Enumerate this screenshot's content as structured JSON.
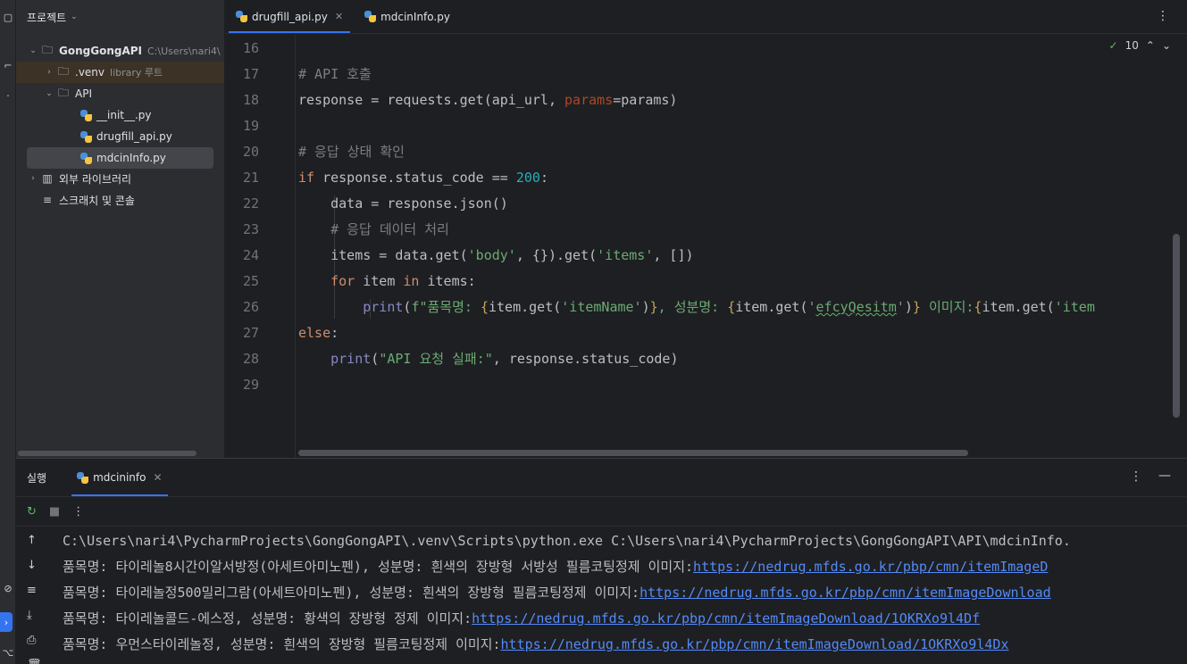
{
  "project": {
    "title": "프로젝트",
    "items": [
      {
        "label": "GongGongAPI",
        "extra": "C:\\Users\\nari4\\"
      },
      {
        "label": ".venv",
        "extra": "library 루트"
      },
      {
        "label": "API"
      },
      {
        "label": "__init__.py"
      },
      {
        "label": "drugfill_api.py"
      },
      {
        "label": "mdcinInfo.py"
      },
      {
        "label": "외부 라이브러리"
      },
      {
        "label": "스크래치 및 콘솔"
      }
    ]
  },
  "editor": {
    "tabs": [
      {
        "label": "drugfill_api.py"
      },
      {
        "label": "mdcinInfo.py"
      }
    ],
    "inspection_count": "10",
    "line_numbers": [
      "16",
      "17",
      "18",
      "19",
      "20",
      "21",
      "22",
      "23",
      "24",
      "25",
      "26",
      "27",
      "28",
      "29"
    ],
    "code": {
      "l17": "# API 호출",
      "l18_a": "response = requests.get(api_url, ",
      "l18_b": "params",
      "l18_c": "=params)",
      "l20": "# 응답 상태 확인",
      "l21_a": "if",
      "l21_b": " response.status_code == ",
      "l21_c": "200",
      "l21_d": ":",
      "l22": "    data = response.json()",
      "l23": "    # 응답 데이터 처리",
      "l24_a": "    items = data.get(",
      "l24_b": "'body'",
      "l24_c": ", {}).get(",
      "l24_d": "'items'",
      "l24_e": ", [])",
      "l25_a": "    ",
      "l25_b": "for",
      "l25_c": " item ",
      "l25_d": "in",
      "l25_e": " items:",
      "l26_a": "        ",
      "l26_b": "print",
      "l26_c": "(",
      "l26_d": "f\"품목명: ",
      "l26_e": "{",
      "l26_f": "item.get(",
      "l26_g": "'itemName'",
      "l26_h": ")",
      "l26_i": "}",
      "l26_j": ", 성분명: ",
      "l26_k": "{",
      "l26_l": "item.get(",
      "l26_m": "'",
      "l26_n": "efcyQesitm",
      "l26_o": "'",
      "l26_p": ")",
      "l26_q": "}",
      "l26_r": " 이미지:",
      "l26_s": "{",
      "l26_t": "item.get(",
      "l26_u": "'item",
      "l27_a": "else",
      "l27_b": ":",
      "l28_a": "    ",
      "l28_b": "print",
      "l28_c": "(",
      "l28_d": "\"API 요청 실패:\"",
      "l28_e": ", response.status_code)"
    }
  },
  "run": {
    "title": "실행",
    "tab_label": "mdcininfo",
    "console": [
      {
        "text": "C:\\Users\\nari4\\PycharmProjects\\GongGongAPI\\.venv\\Scripts\\python.exe C:\\Users\\nari4\\PycharmProjects\\GongGongAPI\\API\\mdcinInfo.",
        "link": ""
      },
      {
        "text": "품목명: 타이레놀8시간이알서방정(아세트아미노펜), 성분명: 흰색의 장방형 서방성 필름코팅정제 이미지:",
        "link": "https://nedrug.mfds.go.kr/pbp/cmn/itemImageD"
      },
      {
        "text": "품목명: 타이레놀정500밀리그람(아세트아미노펜), 성분명: 흰색의 장방형 필름코팅정제 이미지:",
        "link": "https://nedrug.mfds.go.kr/pbp/cmn/itemImageDownload"
      },
      {
        "text": "품목명: 타이레놀콜드-에스정, 성분명: 황색의 장방형 정제 이미지:",
        "link": "https://nedrug.mfds.go.kr/pbp/cmn/itemImageDownload/1OKRXo9l4Df"
      },
      {
        "text": "품목명: 우먼스타이레놀정, 성분명: 흰색의 장방형 필름코팅정제 이미지:",
        "link": "https://nedrug.mfds.go.kr/pbp/cmn/itemImageDownload/1OKRXo9l4Dx"
      }
    ]
  }
}
